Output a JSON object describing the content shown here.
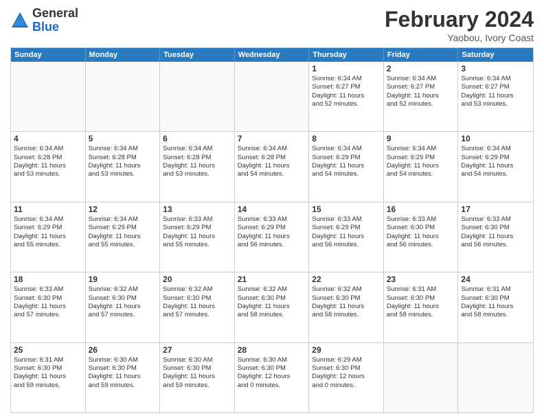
{
  "logo": {
    "general": "General",
    "blue": "Blue"
  },
  "title": "February 2024",
  "subtitle": "Yaobou, Ivory Coast",
  "days": [
    "Sunday",
    "Monday",
    "Tuesday",
    "Wednesday",
    "Thursday",
    "Friday",
    "Saturday"
  ],
  "weeks": [
    [
      {
        "day": "",
        "lines": []
      },
      {
        "day": "",
        "lines": []
      },
      {
        "day": "",
        "lines": []
      },
      {
        "day": "",
        "lines": []
      },
      {
        "day": "1",
        "lines": [
          "Sunrise: 6:34 AM",
          "Sunset: 6:27 PM",
          "Daylight: 11 hours",
          "and 52 minutes."
        ]
      },
      {
        "day": "2",
        "lines": [
          "Sunrise: 6:34 AM",
          "Sunset: 6:27 PM",
          "Daylight: 11 hours",
          "and 52 minutes."
        ]
      },
      {
        "day": "3",
        "lines": [
          "Sunrise: 6:34 AM",
          "Sunset: 6:27 PM",
          "Daylight: 11 hours",
          "and 53 minutes."
        ]
      }
    ],
    [
      {
        "day": "4",
        "lines": [
          "Sunrise: 6:34 AM",
          "Sunset: 6:28 PM",
          "Daylight: 11 hours",
          "and 53 minutes."
        ]
      },
      {
        "day": "5",
        "lines": [
          "Sunrise: 6:34 AM",
          "Sunset: 6:28 PM",
          "Daylight: 11 hours",
          "and 53 minutes."
        ]
      },
      {
        "day": "6",
        "lines": [
          "Sunrise: 6:34 AM",
          "Sunset: 6:28 PM",
          "Daylight: 11 hours",
          "and 53 minutes."
        ]
      },
      {
        "day": "7",
        "lines": [
          "Sunrise: 6:34 AM",
          "Sunset: 6:28 PM",
          "Daylight: 11 hours",
          "and 54 minutes."
        ]
      },
      {
        "day": "8",
        "lines": [
          "Sunrise: 6:34 AM",
          "Sunset: 6:29 PM",
          "Daylight: 11 hours",
          "and 54 minutes."
        ]
      },
      {
        "day": "9",
        "lines": [
          "Sunrise: 6:34 AM",
          "Sunset: 6:29 PM",
          "Daylight: 11 hours",
          "and 54 minutes."
        ]
      },
      {
        "day": "10",
        "lines": [
          "Sunrise: 6:34 AM",
          "Sunset: 6:29 PM",
          "Daylight: 11 hours",
          "and 54 minutes."
        ]
      }
    ],
    [
      {
        "day": "11",
        "lines": [
          "Sunrise: 6:34 AM",
          "Sunset: 6:29 PM",
          "Daylight: 11 hours",
          "and 55 minutes."
        ]
      },
      {
        "day": "12",
        "lines": [
          "Sunrise: 6:34 AM",
          "Sunset: 6:29 PM",
          "Daylight: 11 hours",
          "and 55 minutes."
        ]
      },
      {
        "day": "13",
        "lines": [
          "Sunrise: 6:33 AM",
          "Sunset: 6:29 PM",
          "Daylight: 11 hours",
          "and 55 minutes."
        ]
      },
      {
        "day": "14",
        "lines": [
          "Sunrise: 6:33 AM",
          "Sunset: 6:29 PM",
          "Daylight: 11 hours",
          "and 56 minutes."
        ]
      },
      {
        "day": "15",
        "lines": [
          "Sunrise: 6:33 AM",
          "Sunset: 6:29 PM",
          "Daylight: 11 hours",
          "and 56 minutes."
        ]
      },
      {
        "day": "16",
        "lines": [
          "Sunrise: 6:33 AM",
          "Sunset: 6:30 PM",
          "Daylight: 11 hours",
          "and 56 minutes."
        ]
      },
      {
        "day": "17",
        "lines": [
          "Sunrise: 6:33 AM",
          "Sunset: 6:30 PM",
          "Daylight: 11 hours",
          "and 56 minutes."
        ]
      }
    ],
    [
      {
        "day": "18",
        "lines": [
          "Sunrise: 6:33 AM",
          "Sunset: 6:30 PM",
          "Daylight: 11 hours",
          "and 57 minutes."
        ]
      },
      {
        "day": "19",
        "lines": [
          "Sunrise: 6:32 AM",
          "Sunset: 6:30 PM",
          "Daylight: 11 hours",
          "and 57 minutes."
        ]
      },
      {
        "day": "20",
        "lines": [
          "Sunrise: 6:32 AM",
          "Sunset: 6:30 PM",
          "Daylight: 11 hours",
          "and 57 minutes."
        ]
      },
      {
        "day": "21",
        "lines": [
          "Sunrise: 6:32 AM",
          "Sunset: 6:30 PM",
          "Daylight: 11 hours",
          "and 58 minutes."
        ]
      },
      {
        "day": "22",
        "lines": [
          "Sunrise: 6:32 AM",
          "Sunset: 6:30 PM",
          "Daylight: 11 hours",
          "and 58 minutes."
        ]
      },
      {
        "day": "23",
        "lines": [
          "Sunrise: 6:31 AM",
          "Sunset: 6:30 PM",
          "Daylight: 11 hours",
          "and 58 minutes."
        ]
      },
      {
        "day": "24",
        "lines": [
          "Sunrise: 6:31 AM",
          "Sunset: 6:30 PM",
          "Daylight: 11 hours",
          "and 58 minutes."
        ]
      }
    ],
    [
      {
        "day": "25",
        "lines": [
          "Sunrise: 6:31 AM",
          "Sunset: 6:30 PM",
          "Daylight: 11 hours",
          "and 59 minutes."
        ]
      },
      {
        "day": "26",
        "lines": [
          "Sunrise: 6:30 AM",
          "Sunset: 6:30 PM",
          "Daylight: 11 hours",
          "and 59 minutes."
        ]
      },
      {
        "day": "27",
        "lines": [
          "Sunrise: 6:30 AM",
          "Sunset: 6:30 PM",
          "Daylight: 11 hours",
          "and 59 minutes."
        ]
      },
      {
        "day": "28",
        "lines": [
          "Sunrise: 6:30 AM",
          "Sunset: 6:30 PM",
          "Daylight: 12 hours",
          "and 0 minutes."
        ]
      },
      {
        "day": "29",
        "lines": [
          "Sunrise: 6:29 AM",
          "Sunset: 6:30 PM",
          "Daylight: 12 hours",
          "and 0 minutes."
        ]
      },
      {
        "day": "",
        "lines": []
      },
      {
        "day": "",
        "lines": []
      }
    ]
  ]
}
